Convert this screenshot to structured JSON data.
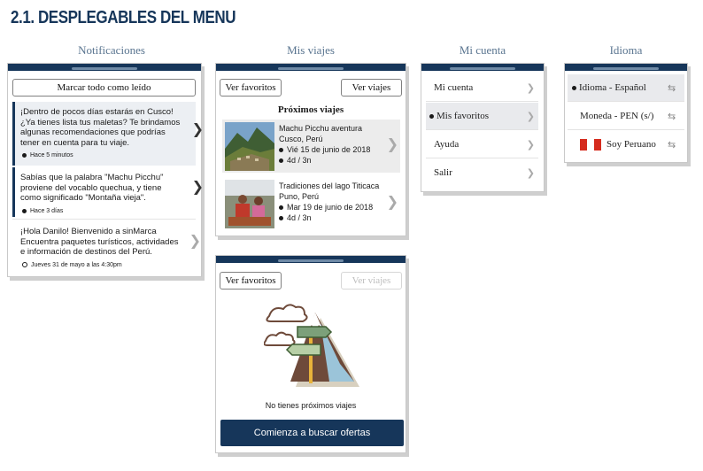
{
  "page_title": "2.1. DESPLEGABLES DEL MENU",
  "columns": {
    "notifications": "Notificaciones",
    "trips": "Mis viajes",
    "account": "Mi cuenta",
    "language": "Idioma"
  },
  "notifications": {
    "mark_all_label": "Marcar todo como leído",
    "items": [
      {
        "line1": "¡Dentro de pocos días estarás en Cusco!",
        "line2": "¿Ya tienes lista tus maletas? Te brindamos",
        "line3": "algunas recomendaciones que podrías",
        "line4": "tener en cuenta para tu viaje.",
        "time": "Hace 5 minutos"
      },
      {
        "line1": "Sabías que la palabra \"Machu Picchu\"",
        "line2": "proviene del vocablo quechua, y tiene",
        "line3": "como significado \"Montaña vieja\".",
        "time": "Hace 3 días"
      },
      {
        "line1": "¡Hola Danilo! Bienvenido a sinMarca",
        "line2": "Encuentra paquetes turísticos, actividades",
        "line3": "e información de destinos del Perú.",
        "time": "Jueves 31 de mayo a las 4:30pm"
      }
    ]
  },
  "trips": {
    "favorites_label": "Ver favoritos",
    "trips_label": "Ver viajes",
    "upcoming_heading": "Próximos viajes",
    "items": [
      {
        "title": "Machu Picchu aventura",
        "place": "Cusco, Perú",
        "date": "Vié 15 de junio de 2018",
        "duration": "4d / 3n"
      },
      {
        "title": "Tradiciones del lago Titicaca",
        "place": "Puno, Perú",
        "date": "Mar 19 de junio de 2018",
        "duration": "4d / 3n"
      }
    ]
  },
  "trips_empty": {
    "favorites_label": "Ver favoritos",
    "trips_label": "Ver viajes",
    "empty_message": "No tienes próximos viajes",
    "cta_label": "Comienza a buscar ofertas"
  },
  "account": {
    "items": [
      {
        "label": "Mi cuenta"
      },
      {
        "label": "Mis favoritos"
      },
      {
        "label": "Ayuda"
      },
      {
        "label": "Salir"
      }
    ]
  },
  "language": {
    "items": [
      {
        "label": "Idioma - Español"
      },
      {
        "label": "Moneda - PEN (s/)"
      },
      {
        "label": "Soy Peruano"
      }
    ]
  },
  "colors": {
    "navy": "#16365a",
    "heading_blue": "#5a7590",
    "peru_red": "#d52b1e"
  }
}
